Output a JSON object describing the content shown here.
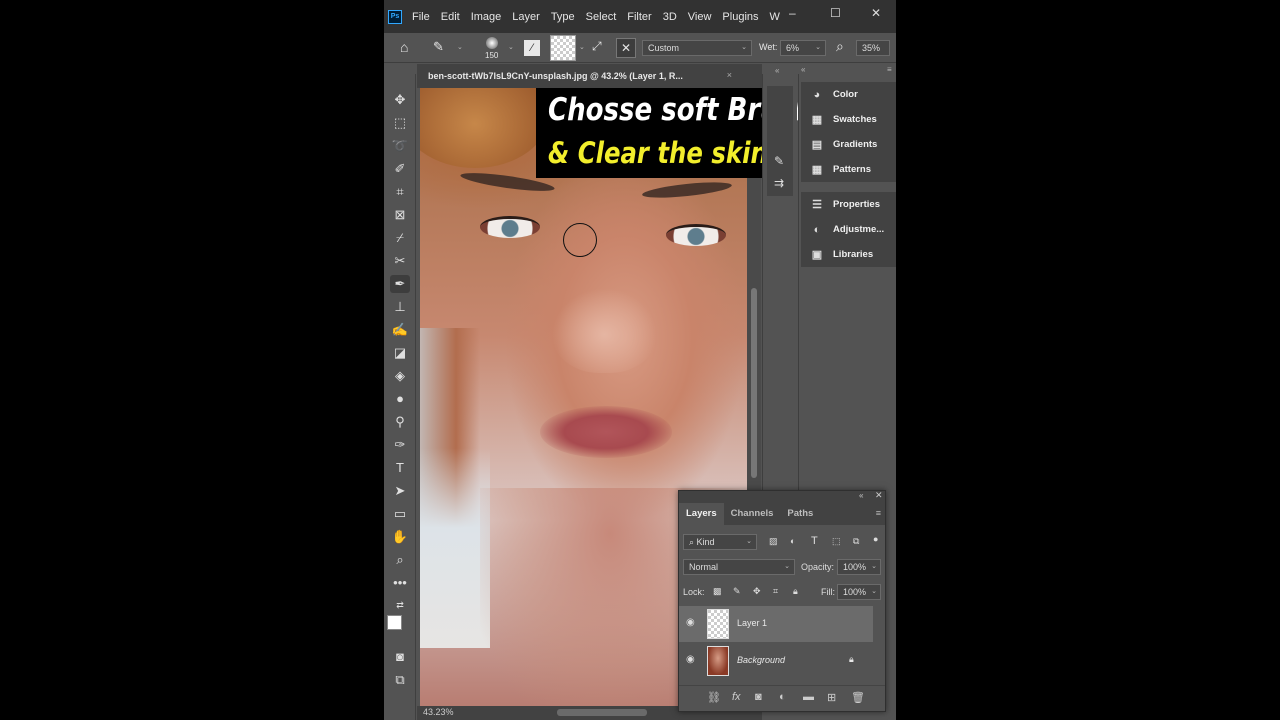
{
  "app": {
    "logo": "Ps"
  },
  "menu": [
    "File",
    "Edit",
    "Image",
    "Layer",
    "Type",
    "Select",
    "Filter",
    "3D",
    "View",
    "Plugins",
    "W"
  ],
  "window_controls": {
    "minimize": "–",
    "maximize": "☐",
    "close": "✕"
  },
  "options_bar": {
    "brush_size": "150",
    "preset": "Custom",
    "wet_label": "Wet:",
    "wet_value": "6%",
    "zoom_value": "35%"
  },
  "document": {
    "tab_title": "ben-scott-tWb7lsL9CnY-unsplash.jpg @ 43.2% (Layer 1, R...",
    "tab_close": "×",
    "zoom_status": "43.23%"
  },
  "caption": {
    "line1": "Chosse soft Brush",
    "line2": "& Clear the skin",
    "line2_color": "#f2ee2c"
  },
  "side_panels": {
    "group1": [
      {
        "label": "Color",
        "icon": "palette-icon"
      },
      {
        "label": "Swatches",
        "icon": "swatches-grid-icon"
      },
      {
        "label": "Gradients",
        "icon": "gradient-icon"
      },
      {
        "label": "Patterns",
        "icon": "patterns-grid-icon"
      }
    ],
    "group2": [
      {
        "label": "Properties",
        "icon": "sliders-icon"
      },
      {
        "label": "Adjustme...",
        "icon": "adjustment-circle-icon"
      },
      {
        "label": "Libraries",
        "icon": "libraries-icon"
      }
    ]
  },
  "layers_panel": {
    "tabs": [
      "Layers",
      "Channels",
      "Paths"
    ],
    "active_tab": "Layers",
    "filter_kind": "Kind",
    "blend_mode": "Normal",
    "opacity_label": "Opacity:",
    "opacity_value": "100%",
    "lock_label": "Lock:",
    "fill_label": "Fill:",
    "fill_value": "100%",
    "layers": [
      {
        "name": "Layer 1",
        "selected": true
      },
      {
        "name": "Background",
        "selected": false,
        "locked": true
      }
    ]
  }
}
